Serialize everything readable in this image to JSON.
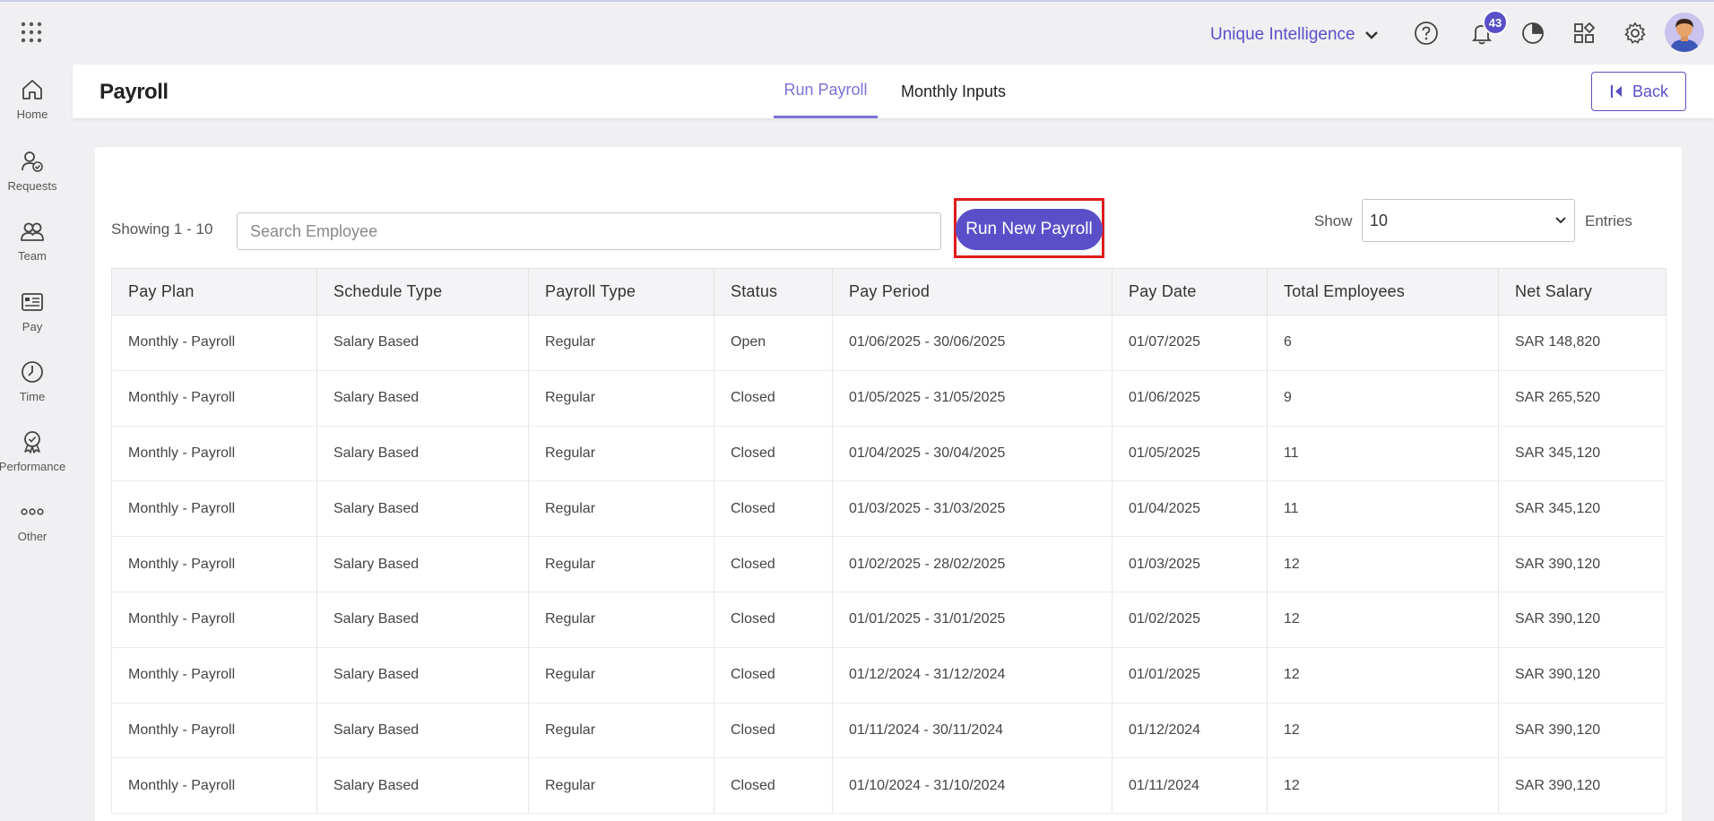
{
  "topbar": {
    "org_name": "Unique Intelligence",
    "notification_count": "43"
  },
  "sidebar": {
    "items": [
      {
        "label": "Home",
        "icon": "home-icon"
      },
      {
        "label": "Requests",
        "icon": "requests-icon"
      },
      {
        "label": "Team",
        "icon": "team-icon"
      },
      {
        "label": "Pay",
        "icon": "pay-icon"
      },
      {
        "label": "Time",
        "icon": "clock-icon"
      },
      {
        "label": "Performance",
        "icon": "award-icon"
      },
      {
        "label": "Other",
        "icon": "more-icon"
      }
    ]
  },
  "header": {
    "title": "Payroll",
    "tabs": [
      {
        "label": "Run Payroll",
        "active": true
      },
      {
        "label": "Monthly Inputs",
        "active": false
      }
    ],
    "back_label": "Back"
  },
  "toolbar": {
    "showing": "Showing 1 - 10",
    "search_placeholder": "Search Employee",
    "run_button": "Run New Payroll",
    "show_label": "Show",
    "entries_value": "10",
    "entries_label": "Entries"
  },
  "table": {
    "columns": [
      "Pay Plan",
      "Schedule Type",
      "Payroll Type",
      "Status",
      "Pay Period",
      "Pay Date",
      "Total Employees",
      "Net Salary"
    ],
    "rows": [
      [
        "Monthly - Payroll",
        "Salary Based",
        "Regular",
        "Open",
        "01/06/2025 - 30/06/2025",
        "01/07/2025",
        "6",
        "SAR 148,820"
      ],
      [
        "Monthly - Payroll",
        "Salary Based",
        "Regular",
        "Closed",
        "01/05/2025 - 31/05/2025",
        "01/06/2025",
        "9",
        "SAR 265,520"
      ],
      [
        "Monthly - Payroll",
        "Salary Based",
        "Regular",
        "Closed",
        "01/04/2025 - 30/04/2025",
        "01/05/2025",
        "11",
        "SAR 345,120"
      ],
      [
        "Monthly - Payroll",
        "Salary Based",
        "Regular",
        "Closed",
        "01/03/2025 - 31/03/2025",
        "01/04/2025",
        "11",
        "SAR 345,120"
      ],
      [
        "Monthly - Payroll",
        "Salary Based",
        "Regular",
        "Closed",
        "01/02/2025 - 28/02/2025",
        "01/03/2025",
        "12",
        "SAR 390,120"
      ],
      [
        "Monthly - Payroll",
        "Salary Based",
        "Regular",
        "Closed",
        "01/01/2025 - 31/01/2025",
        "01/02/2025",
        "12",
        "SAR 390,120"
      ],
      [
        "Monthly - Payroll",
        "Salary Based",
        "Regular",
        "Closed",
        "01/12/2024 - 31/12/2024",
        "01/01/2025",
        "12",
        "SAR 390,120"
      ],
      [
        "Monthly - Payroll",
        "Salary Based",
        "Regular",
        "Closed",
        "01/11/2024 - 30/11/2024",
        "01/12/2024",
        "12",
        "SAR 390,120"
      ],
      [
        "Monthly - Payroll",
        "Salary Based",
        "Regular",
        "Closed",
        "01/10/2024 - 31/10/2024",
        "01/11/2024",
        "12",
        "SAR 390,120"
      ]
    ]
  },
  "colors": {
    "accent": "#5b4fc9",
    "tab_active": "#7b72d8",
    "highlight": "#e01b1b"
  }
}
